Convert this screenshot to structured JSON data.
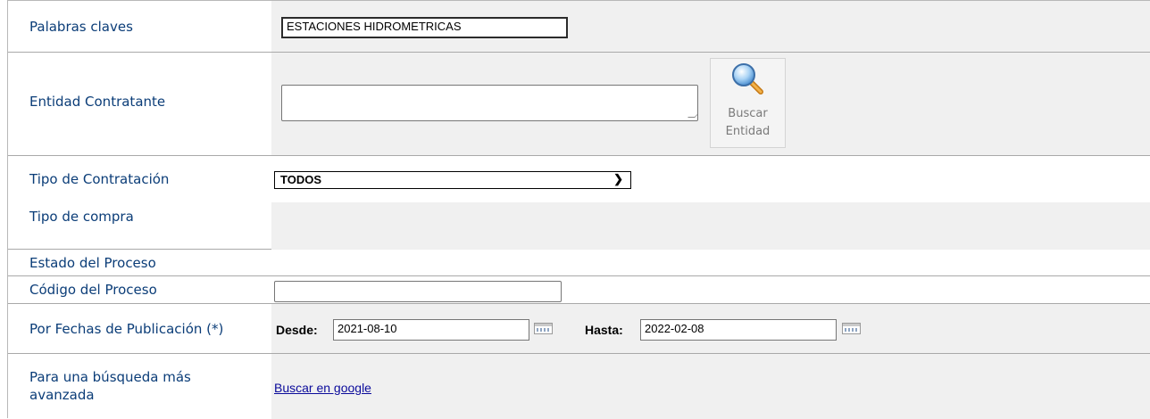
{
  "fields": {
    "keywords": {
      "label": "Palabras claves",
      "value": "ESTACIONES HIDROMETRICAS"
    },
    "entity": {
      "label": "Entidad Contratante",
      "value": "",
      "button_line1": "Buscar",
      "button_line2": "Entidad"
    },
    "contract_type": {
      "label": "Tipo de Contratación",
      "selected": "TODOS"
    },
    "purchase_type": {
      "label": "Tipo de compra"
    },
    "process_state": {
      "label": "Estado del Proceso"
    },
    "process_code": {
      "label": "Código del Proceso",
      "value": ""
    },
    "publication_dates": {
      "label": "Por Fechas de Publicación (*)",
      "from_label": "Desde:",
      "from_value": "2021-08-10",
      "to_label": "Hasta:",
      "to_value": "2022-02-08"
    },
    "advanced": {
      "label_line1": "Para una búsqueda más",
      "label_line2": "avanzada",
      "link": "Buscar en google"
    }
  },
  "icons": {
    "search": "magnifier-icon",
    "calendar": "calendar-icon",
    "dropdown": "chevron-down-icon"
  },
  "colors": {
    "label_text": "#0b3d78",
    "value_bg": "#f0f0f0",
    "link": "#0b0b9b"
  }
}
